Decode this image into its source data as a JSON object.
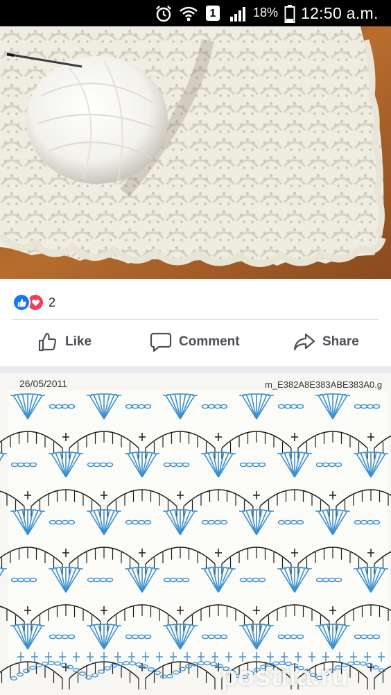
{
  "status_bar": {
    "battery_percent": "18%",
    "sim_slot": "1",
    "time": "12:50 a.m."
  },
  "post": {
    "reactions": {
      "count": "2",
      "types": [
        "like-icon",
        "love-icon"
      ]
    },
    "actions": {
      "like_label": "Like",
      "comment_label": "Comment",
      "share_label": "Share"
    }
  },
  "chart_image": {
    "date": "26/05/2011",
    "filename": "m_E382A8E383ABE383A0.g",
    "watermark": "postila.ru"
  },
  "colors": {
    "facebook_blue": "#1877f2",
    "love_red": "#f33e58",
    "action_gray": "#4b4f56",
    "chart_blue": "#3a8fd0",
    "chart_black": "#1a1a1a"
  }
}
